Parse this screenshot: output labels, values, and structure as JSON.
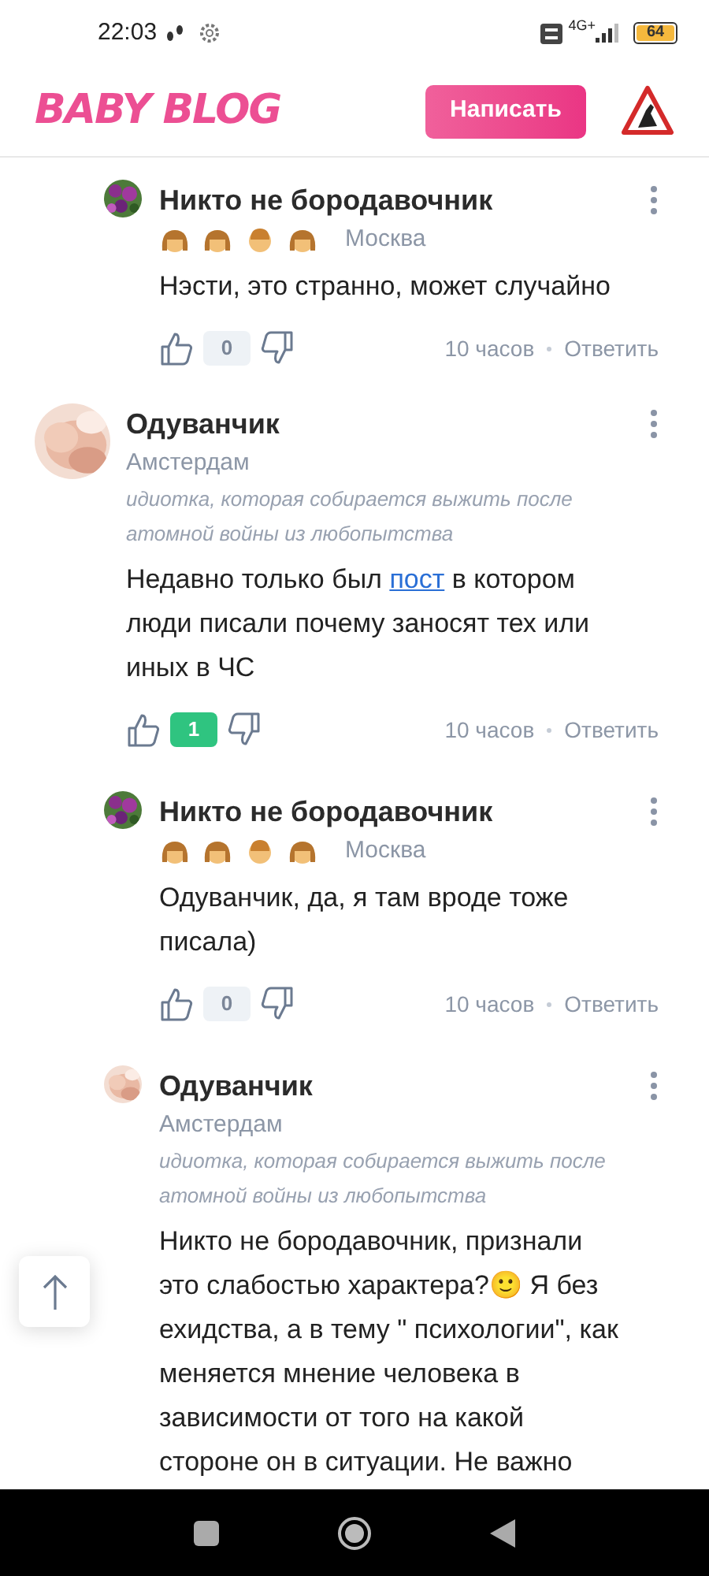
{
  "status_bar": {
    "time": "22:03",
    "network": "4G+",
    "battery": "64"
  },
  "header": {
    "logo": "BABY BLOG",
    "write_button": "Написать"
  },
  "comments": [
    {
      "kind": "reply",
      "avatar": {
        "kind": "picture"
      },
      "author": "Никто не бородавочник",
      "badges": [
        {
          "kind": "girl"
        },
        {
          "kind": "girl"
        },
        {
          "kind": "boy"
        },
        {
          "kind": "girl"
        }
      ],
      "city": "Москва",
      "body": [
        {
          "text": "Нэсти, это странно, может случайно"
        }
      ],
      "rating": "0",
      "positive": false,
      "time": "10 часов",
      "reply": "Ответить"
    },
    {
      "kind": "top",
      "avatar": {
        "kind": "picture"
      },
      "author": "Одуванчик",
      "city": "Амстердам",
      "status": "идиотка, которая собирается выжить после атомной войны из любопытства",
      "body": [
        {
          "text": "Недавно только был "
        },
        {
          "text": "пост",
          "link": true
        },
        {
          "text": " в котором люди писали почему заносят тех или иных в ЧС"
        }
      ],
      "rating": "1",
      "positive": true,
      "time": "10 часов",
      "reply": "Ответить"
    },
    {
      "kind": "reply",
      "avatar": {
        "kind": "picture"
      },
      "author": "Никто не бородавочник",
      "badges": [
        {
          "kind": "girl"
        },
        {
          "kind": "girl"
        },
        {
          "kind": "boy"
        },
        {
          "kind": "girl"
        }
      ],
      "city": "Москва",
      "body": [
        {
          "text": "Одуванчик, да, я там вроде тоже писала)"
        }
      ],
      "rating": "0",
      "positive": false,
      "time": "10 часов",
      "reply": "Ответить"
    },
    {
      "kind": "reply",
      "avatar": {
        "kind": "picture"
      },
      "author": "Одуванчик",
      "city": "Амстердам",
      "status": "идиотка, которая собирается выжить после атомной войны из любопытства",
      "body": [
        {
          "text": "Никто не бородавочник, признали это слабостью характера?🙂 Я без ехидства, а в тему \" психологии\", как меняется мнение человека в зависимости от того на какой стороне он в ситуации. Не важно"
        }
      ]
    }
  ]
}
